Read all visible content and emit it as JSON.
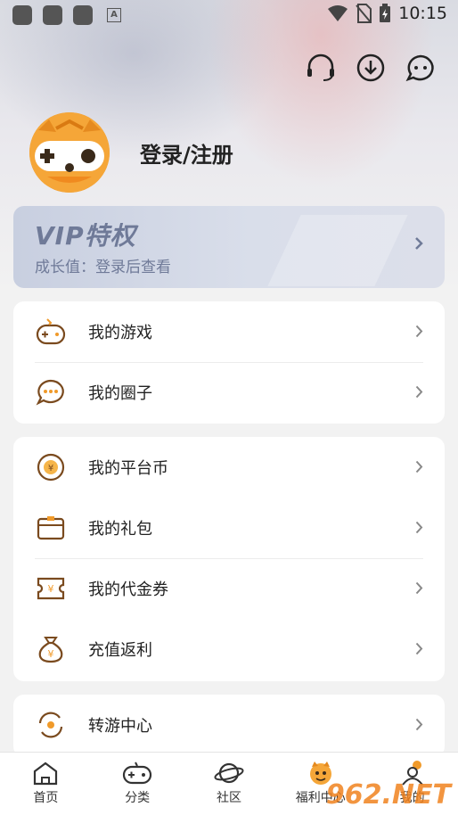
{
  "status_bar": {
    "time": "10:15"
  },
  "profile": {
    "login_text": "登录/注册"
  },
  "vip": {
    "title": "VIP特权",
    "subtitle": "成长值：登录后查看"
  },
  "section1": {
    "items": [
      {
        "label": "我的游戏",
        "icon": "gamepad-icon"
      },
      {
        "label": "我的圈子",
        "icon": "chat-bubble-icon"
      }
    ]
  },
  "section2": {
    "items": [
      {
        "label": "我的平台币",
        "icon": "coin-icon"
      },
      {
        "label": "我的礼包",
        "icon": "gift-icon"
      },
      {
        "label": "我的代金券",
        "icon": "voucher-icon"
      },
      {
        "label": "充值返利",
        "icon": "money-bag-icon"
      }
    ]
  },
  "section3": {
    "items": [
      {
        "label": "转游中心",
        "icon": "transfer-icon"
      }
    ]
  },
  "bottom_nav": {
    "items": [
      {
        "label": "首页"
      },
      {
        "label": "分类"
      },
      {
        "label": "社区"
      },
      {
        "label": "福利中心"
      },
      {
        "label": "我的"
      }
    ]
  },
  "watermark": "962.NET",
  "colors": {
    "accent": "#f09a2a",
    "vip_text": "#6f7a98",
    "icon_brown": "#7a4a1e"
  }
}
